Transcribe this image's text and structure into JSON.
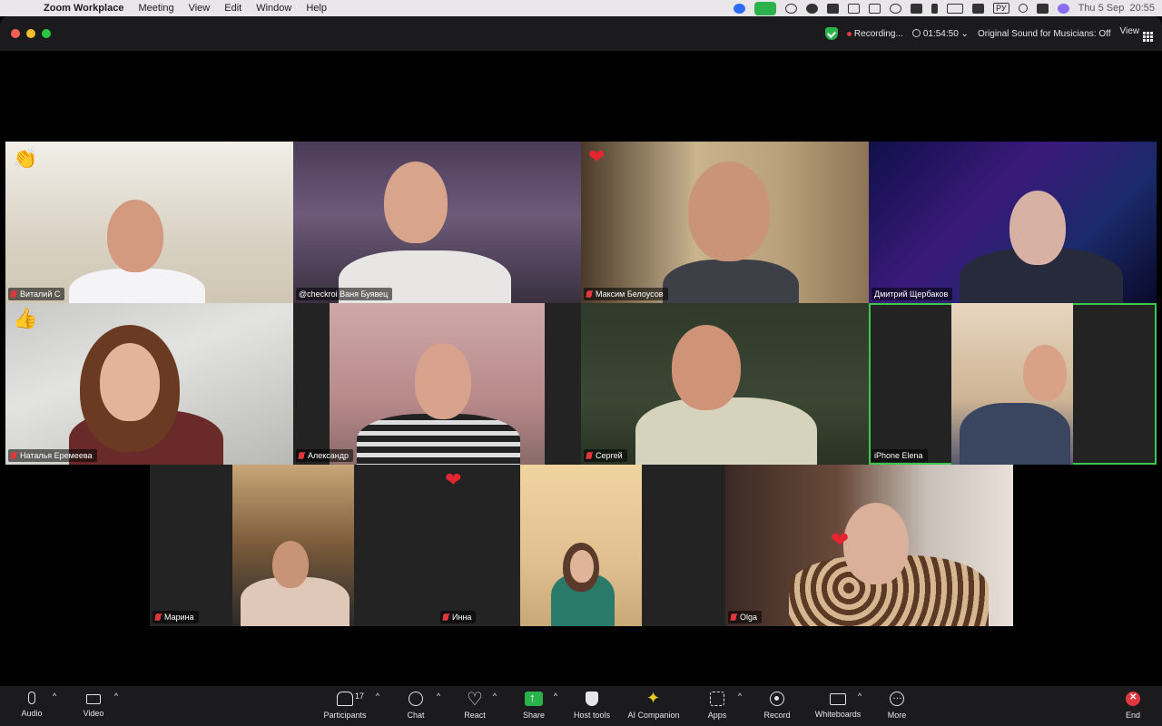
{
  "menubar": {
    "app_name": "Zoom Workplace",
    "menus": [
      "Meeting",
      "View",
      "Edit",
      "Window",
      "Help"
    ],
    "keyboard_layout": "РУ",
    "datetime": "Thu 5 Sep  20:55"
  },
  "topbar": {
    "recording_label": "Recording...",
    "timer": "01:54:50",
    "original_sound": "Original Sound for Musicians: Off",
    "view_label": "View"
  },
  "tiles": [
    {
      "name": "Виталий С",
      "muted": true,
      "reaction": "👏"
    },
    {
      "name": "@checkroi Ваня Буявец",
      "muted": false,
      "reaction": ""
    },
    {
      "name": "Максим Белоусов",
      "muted": true,
      "reaction": "❤"
    },
    {
      "name": "Дмитрий Щербаков",
      "muted": false,
      "reaction": ""
    },
    {
      "name": "Наталья Еремеева",
      "muted": true,
      "reaction": "👍"
    },
    {
      "name": "Александр",
      "muted": true,
      "reaction": ""
    },
    {
      "name": "Сергей",
      "muted": true,
      "reaction": ""
    },
    {
      "name": "iPhone Elena",
      "muted": false,
      "reaction": "",
      "active_speaker": true
    },
    {
      "name": "Марина",
      "muted": true,
      "reaction": ""
    },
    {
      "name": "Инна",
      "muted": true,
      "reaction": "❤"
    },
    {
      "name": "",
      "muted": false,
      "reaction": ""
    },
    {
      "name": "Olga",
      "muted": true,
      "reaction": "❤"
    }
  ],
  "toolbar": {
    "audio": "Audio",
    "video": "Video",
    "participants": "Participants",
    "participants_count": "17",
    "chat": "Chat",
    "react": "React",
    "share": "Share",
    "host_tools": "Host tools",
    "ai_companion": "AI Companion",
    "apps": "Apps",
    "record": "Record",
    "whiteboards": "Whiteboards",
    "more": "More",
    "end": "End"
  },
  "colors": {
    "active_speaker": "#3ec84b",
    "end_red": "#e0383e",
    "share_green": "#2bb24c"
  }
}
